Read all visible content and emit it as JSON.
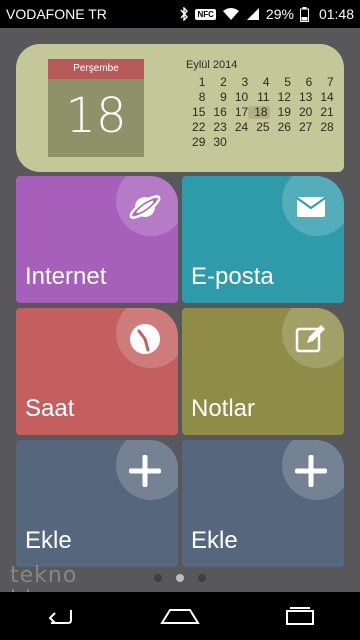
{
  "status_bar": {
    "carrier": "VODAFONE TR",
    "nfc": "NFC",
    "battery": "29%",
    "time": "01:48",
    "icons": [
      "bluetooth-icon",
      "nfc-icon",
      "wifi-icon",
      "signal-icon",
      "battery-icon"
    ]
  },
  "calendar": {
    "weekday": "Perşembe",
    "day": "18",
    "month_label": "Eylül 2014",
    "days": [
      "1",
      "2",
      "3",
      "4",
      "5",
      "6",
      "7",
      "8",
      "9",
      "10",
      "11",
      "12",
      "13",
      "14",
      "15",
      "16",
      "17",
      "18",
      "19",
      "20",
      "21",
      "22",
      "23",
      "24",
      "25",
      "26",
      "27",
      "28",
      "29",
      "30"
    ],
    "today": "18",
    "colors": {
      "background": "#c4c798",
      "day_card": "#8f9168",
      "header": "#b85a5a"
    }
  },
  "tiles": [
    {
      "label": "Internet",
      "icon": "browser-planet-icon",
      "color": "#a65fbb"
    },
    {
      "label": "E-posta",
      "icon": "mail-envelope-icon",
      "color": "#2e9bab"
    },
    {
      "label": "Saat",
      "icon": "clock-icon",
      "color": "#c45f60"
    },
    {
      "label": "Notlar",
      "icon": "notes-edit-icon",
      "color": "#8e8c46"
    },
    {
      "label": "Ekle",
      "icon": "plus-icon",
      "color": "#56677d"
    },
    {
      "label": "Ekle",
      "icon": "plus-icon",
      "color": "#56677d"
    }
  ],
  "pager": {
    "pages": 3,
    "active": 2
  },
  "watermark": {
    "line1": "tekno",
    "line2": "blog"
  },
  "nav": [
    "back-icon",
    "home-icon",
    "recent-apps-icon"
  ]
}
